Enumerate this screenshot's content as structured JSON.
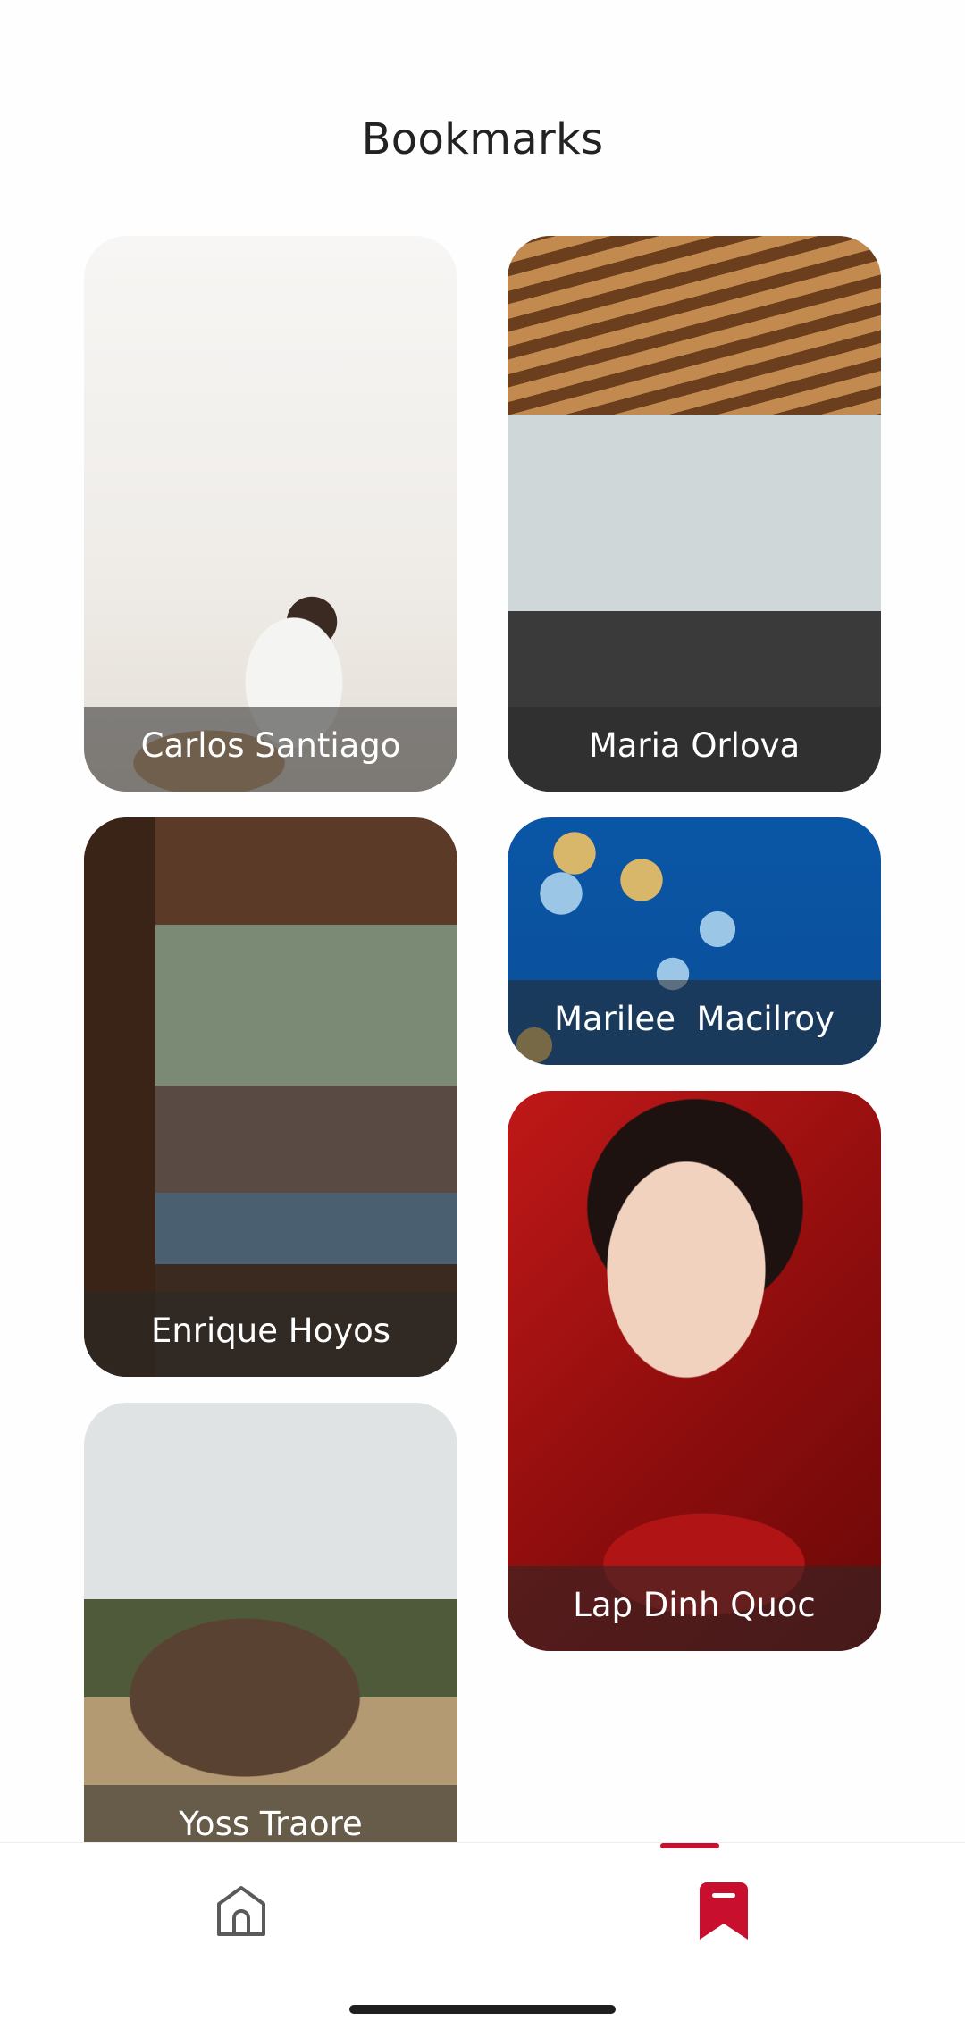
{
  "header": {
    "title": "Bookmarks"
  },
  "bookmarks": [
    {
      "name": "Carlos Santiago",
      "photo": "father-lifting-baby"
    },
    {
      "name": "Maria Orlova",
      "photo": "modern-living-room"
    },
    {
      "name": "Enrique Hoyos",
      "photo": "cabin-interior"
    },
    {
      "name": "Marilee  Macilroy",
      "photo": "balloons-blue-sky"
    },
    {
      "name": "Lap Dinh Quoc",
      "photo": "woman-red-portrait"
    },
    {
      "name": "Yoss Traore",
      "photo": "deer-in-field"
    }
  ],
  "tabbar": {
    "tabs": [
      {
        "icon": "home-icon",
        "active": false
      },
      {
        "icon": "bookmark-icon",
        "active": true
      }
    ],
    "accent_color": "#c8102e",
    "inactive_color": "#4a4a4a"
  }
}
